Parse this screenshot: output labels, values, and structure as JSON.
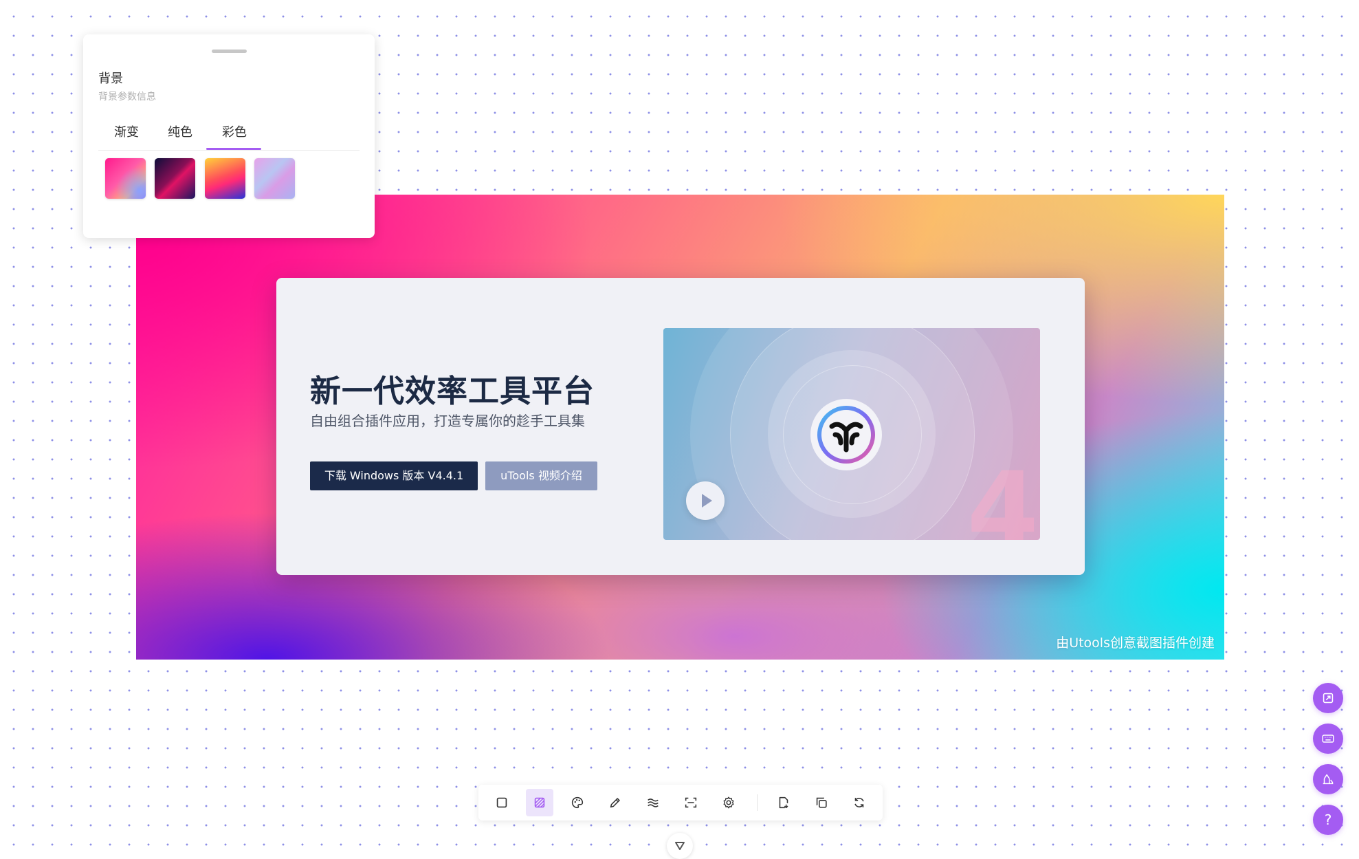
{
  "panel": {
    "title": "背景",
    "subtitle": "背景参数信息",
    "tabs": [
      {
        "label": "渐变"
      },
      {
        "label": "纯色"
      },
      {
        "label": "彩色"
      }
    ],
    "active_tab": "彩色",
    "swatches": [
      "gradient-pink-blue",
      "gradient-dark-navy-red",
      "gradient-yellow-red-blue",
      "gradient-lilac-pastel"
    ]
  },
  "canvas": {
    "hero_title": "新一代效率工具平台",
    "hero_subtitle": "自由组合插件应用，打造专属你的趁手工具集",
    "download_button": "下载 Windows 版本 V4.4.1",
    "video_button": "uTools 视频介绍",
    "video_watermark": "4",
    "credit": "由Utools创意截图插件创建"
  },
  "toolbar": {
    "tools": [
      "crop-icon",
      "background-icon",
      "palette-icon",
      "pen-icon",
      "waves-icon",
      "scan-icon",
      "gear-icon",
      "save-file-icon",
      "copy-icon",
      "refresh-icon"
    ],
    "active_tool": "background-icon"
  },
  "side_buttons": {
    "icons": [
      "pin-icon",
      "keyboard-icon",
      "chart-icon",
      "help-icon"
    ],
    "help_label": "?"
  },
  "colors": {
    "accent": "#a45cf2",
    "card_bg": "#f0f1f6",
    "primary_button": "#1b2a4a",
    "secondary_button": "#8e9bbf",
    "hero_text": "#1c2a44"
  }
}
